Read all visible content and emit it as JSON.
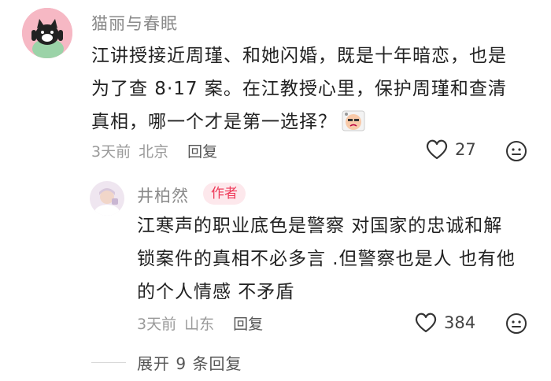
{
  "comments": [
    {
      "username": "猫丽与春眠",
      "body_lines": [
        "江讲授接近周瑾、和她闪婚，既是十年暗恋，也是",
        "为了查 8·17 案。在江教授心里，保护周瑾和查清",
        "真相，哪一个才是第一选择？"
      ],
      "sticker": "thinking-sticker-icon",
      "time": "3天前",
      "location": "北京",
      "reply_label": "回复",
      "likes": "27"
    },
    {
      "username": "井柏然",
      "badge": "作者",
      "body_lines": [
        "江寒声的职业底色是警察 对国家的忠诚和解",
        "锁案件的真相不必多言 .但警察也是人 也有他",
        "的个人情感 不矛盾"
      ],
      "time": "3天前",
      "location": "山东",
      "reply_label": "回复",
      "likes": "384"
    }
  ],
  "expand_label": "展开 9 条回复",
  "colors": {
    "badge_text": "#ee3b5a",
    "badge_bg": "#fde8ec",
    "meta_gray": "#9a9a9a"
  }
}
